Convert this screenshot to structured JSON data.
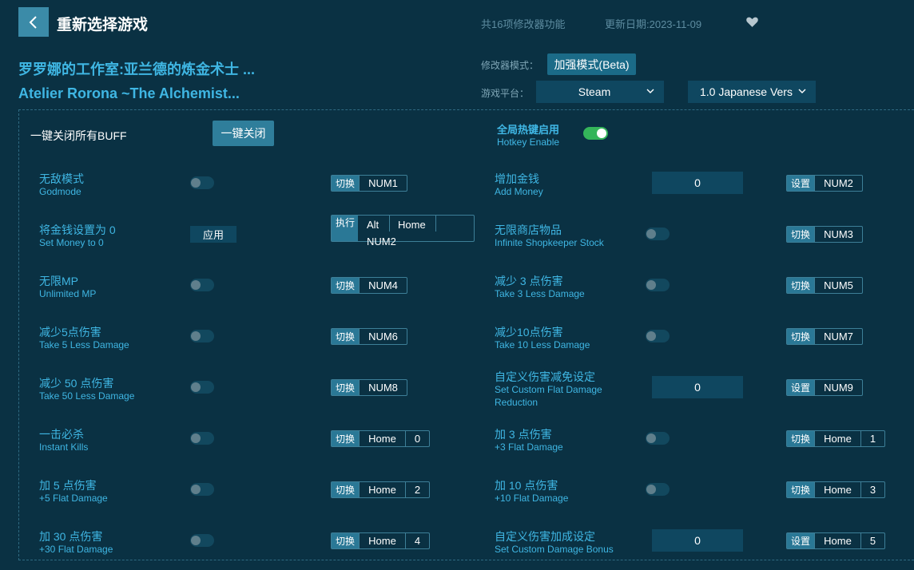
{
  "header": {
    "title": "重新选择游戏",
    "feature_count": "共16项修改器功能",
    "update_date": "更新日期:2023-11-09"
  },
  "game": {
    "title_cn": "罗罗娜的工作室:亚兰德的炼金术士 ...",
    "title_en": "Atelier Rorona ~The Alchemist..."
  },
  "settings": {
    "mode_label": "修改器模式：",
    "mode_value": "加强模式(Beta)",
    "platform_label": "游戏平台：",
    "platform_value": "Steam",
    "version_value": "1.0 Japanese Vers"
  },
  "top_controls": {
    "close_all_label": "一键关闭所有BUFF",
    "close_all_button": "一键关闭",
    "hotkey_cn": "全局热键启用",
    "hotkey_en": "Hotkey Enable"
  },
  "features_left": [
    {
      "cn": "无敌模式",
      "en": "Godmode",
      "action": "切换",
      "keys": [
        "NUM1"
      ]
    },
    {
      "cn": "将金钱设置为 0",
      "en": "Set Money to 0",
      "apply": "应用",
      "action": "执行",
      "keys": [
        "Alt",
        "Home",
        "NUM2"
      ]
    },
    {
      "cn": "无限MP",
      "en": "Unlimited MP",
      "action": "切换",
      "keys": [
        "NUM4"
      ]
    },
    {
      "cn": "减少5点伤害",
      "en": "Take 5 Less Damage",
      "action": "切换",
      "keys": [
        "NUM6"
      ]
    },
    {
      "cn": "减少 50 点伤害",
      "en": "Take 50 Less Damage",
      "action": "切换",
      "keys": [
        "NUM8"
      ]
    },
    {
      "cn": "一击必杀",
      "en": "Instant Kills",
      "action": "切换",
      "keys": [
        "Home",
        "0"
      ]
    },
    {
      "cn": "加 5 点伤害",
      "en": "+5 Flat Damage",
      "action": "切换",
      "keys": [
        "Home",
        "2"
      ]
    },
    {
      "cn": "加 30 点伤害",
      "en": "+30 Flat Damage",
      "action": "切换",
      "keys": [
        "Home",
        "4"
      ]
    }
  ],
  "features_right": [
    {
      "cn": "增加金钱",
      "en": "Add Money",
      "value": "0",
      "action": "设置",
      "keys": [
        "NUM2"
      ]
    },
    {
      "cn": "无限商店物品",
      "en": "Infinite Shopkeeper Stock",
      "action": "切换",
      "keys": [
        "NUM3"
      ]
    },
    {
      "cn": "减少 3 点伤害",
      "en": "Take 3 Less Damage",
      "action": "切换",
      "keys": [
        "NUM5"
      ]
    },
    {
      "cn": "减少10点伤害",
      "en": "Take 10 Less Damage",
      "action": "切换",
      "keys": [
        "NUM7"
      ]
    },
    {
      "cn": "自定义伤害减免设定",
      "en": "Set Custom Flat Damage",
      "en2": "Reduction",
      "value": "0",
      "action": "设置",
      "keys": [
        "NUM9"
      ]
    },
    {
      "cn": "加 3 点伤害",
      "en": "+3 Flat Damage",
      "action": "切换",
      "keys": [
        "Home",
        "1"
      ]
    },
    {
      "cn": "加 10 点伤害",
      "en": "+10 Flat Damage",
      "action": "切换",
      "keys": [
        "Home",
        "3"
      ]
    },
    {
      "cn": "自定义伤害加成设定",
      "en": "Set Custom Damage Bonus",
      "value": "0",
      "action": "设置",
      "keys": [
        "Home",
        "5"
      ]
    }
  ],
  "colors": {
    "background": "#0a3143",
    "accent": "#3fb6e3",
    "button": "#2f7e9b",
    "toggle_on": "#34b55a"
  },
  "icons": {
    "back": "chevron-left-icon",
    "favorite": "heart-icon",
    "dropdown": "chevron-down-icon"
  }
}
